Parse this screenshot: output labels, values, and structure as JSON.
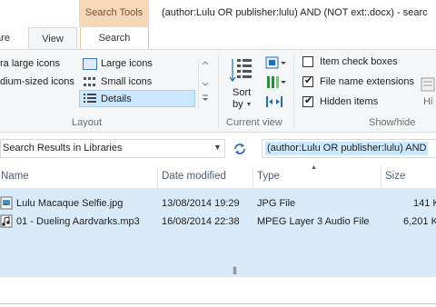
{
  "window": {
    "context_tab_group": "Search Tools",
    "title": "(author:Lulu OR publisher:lulu) AND (NOT ext:.docx) - searc"
  },
  "tabs": {
    "share": "are",
    "view": "View",
    "search": "Search"
  },
  "ribbon": {
    "layout": {
      "items": {
        "extra_large_icons": "ra large icons",
        "large_icons": "Large icons",
        "medium_icons": "dium-sized icons",
        "small_icons": "Small icons",
        "details": "Details"
      },
      "selected": "Details",
      "group_label": "Layout"
    },
    "current_view": {
      "sort_by": "Sort\nby",
      "sort_label": "Sort",
      "by_label": "by",
      "group_label": "Current view"
    },
    "show_hide": {
      "item_check_boxes": "Item check boxes",
      "file_name_extensions": "File name extensions",
      "hidden_items": "Hidden items",
      "checked": {
        "item_check_boxes": false,
        "file_name_extensions": true,
        "hidden_items": true
      },
      "hide_label": "Hi",
      "group_label": "Show/hide"
    }
  },
  "address": {
    "location": "Search Results in Libraries",
    "search_query": "(author:Lulu OR publisher:lulu) AND"
  },
  "list": {
    "columns": [
      "Name",
      "Date modified",
      "Type",
      "Size"
    ],
    "rows": [
      {
        "name": "Lulu Macaque Selfie.jpg",
        "date": "13/08/2014 19:29",
        "type": "JPG File",
        "size": "141 K"
      },
      {
        "name": "01 - Dueling Aardvarks.mp3",
        "date": "16/08/2014 22:38",
        "type": "MPEG Layer 3 Audio File",
        "size": "6,201 K"
      }
    ]
  },
  "icons": {
    "sort": "sort-icon",
    "refresh": "refresh-icon",
    "dropdown": "chevron-down-icon"
  },
  "colors": {
    "selection": "#cce8ff",
    "context_tab": "#f6d8b8",
    "list_bg": "#d9ebf9"
  }
}
